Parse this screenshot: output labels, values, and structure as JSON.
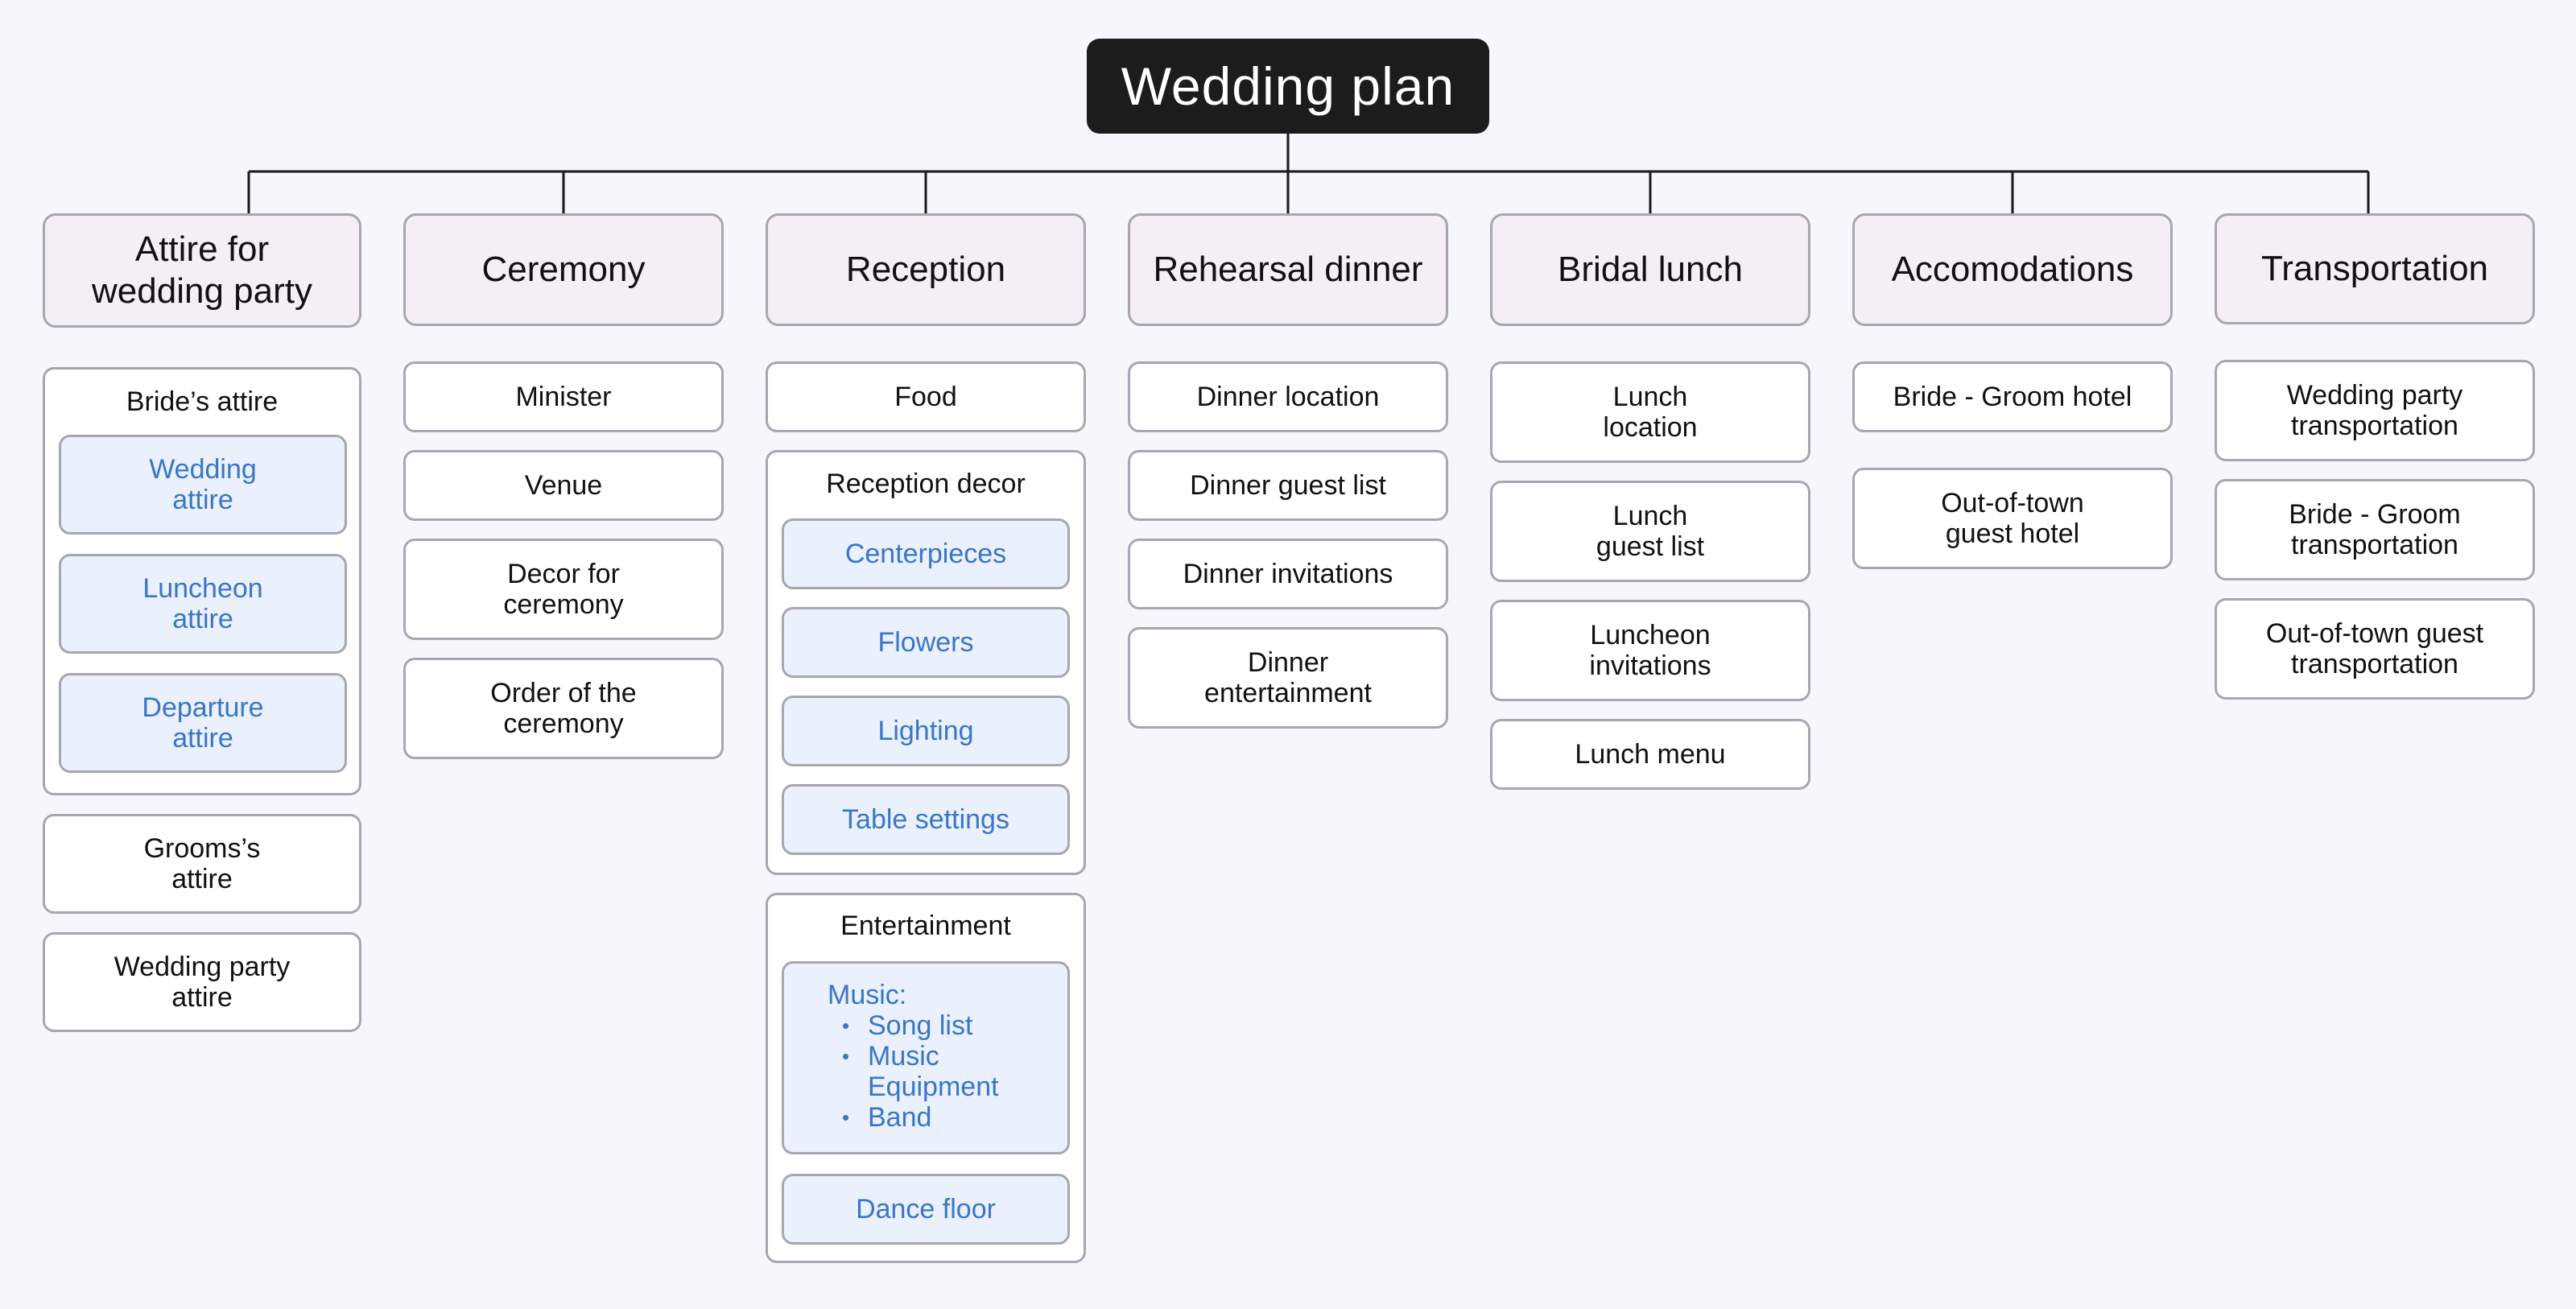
{
  "title": "Wedding plan",
  "columns": [
    {
      "heading_lines": [
        "Attire for",
        "wedding party"
      ],
      "brides_group": {
        "title": "Bride’s attire",
        "items": [
          [
            "Wedding",
            "attire"
          ],
          [
            "Luncheon",
            "attire"
          ],
          [
            "Departure",
            "attire"
          ]
        ]
      },
      "cards": [
        [
          "Grooms’s",
          "attire"
        ],
        [
          "Wedding party",
          "attire"
        ]
      ]
    },
    {
      "heading": "Ceremony",
      "cards": [
        [
          "Minister"
        ],
        [
          "Venue"
        ],
        [
          "Decor for",
          "ceremony"
        ],
        [
          "Order of the",
          "ceremony"
        ]
      ]
    },
    {
      "heading": "Reception",
      "cards": [
        [
          "Food"
        ]
      ],
      "decor_group": {
        "title": "Reception decor",
        "items": [
          "Centerpieces",
          "Flowers",
          "Lighting",
          "Table settings"
        ]
      },
      "entertainment_group": {
        "title": "Entertainment",
        "music_label": "Music:",
        "music_items": [
          "Song list",
          [
            "Music",
            "Equipment"
          ],
          "Band"
        ],
        "dance_floor": "Dance floor"
      }
    },
    {
      "heading": "Rehearsal dinner",
      "cards": [
        [
          "Dinner location"
        ],
        [
          "Dinner guest list"
        ],
        [
          "Dinner invitations"
        ],
        [
          "Dinner",
          "entertainment"
        ]
      ]
    },
    {
      "heading": "Bridal lunch",
      "cards": [
        [
          "Lunch",
          "location"
        ],
        [
          "Lunch",
          "guest list"
        ],
        [
          "Luncheon",
          "invitations"
        ],
        [
          "Lunch menu"
        ]
      ]
    },
    {
      "heading": "Accomodations",
      "cards": [
        [
          "Bride - Groom hotel"
        ],
        [
          "Out-of-town",
          "guest hotel"
        ]
      ]
    },
    {
      "heading": "Transportation",
      "cards": [
        [
          "Wedding party",
          "transportation"
        ],
        [
          "Bride - Groom",
          "transportation"
        ],
        [
          "Out-of-town guest",
          "transportation"
        ]
      ]
    }
  ],
  "colors": {
    "background": "#f6f6fb",
    "root_fill": "#1c1c1c",
    "header_fill": "#f4eff4",
    "subitem_fill": "#eaf0fc",
    "subitem_text": "#3a76c8",
    "border": "#a8a6b0",
    "connector": "#1a1a1a"
  }
}
